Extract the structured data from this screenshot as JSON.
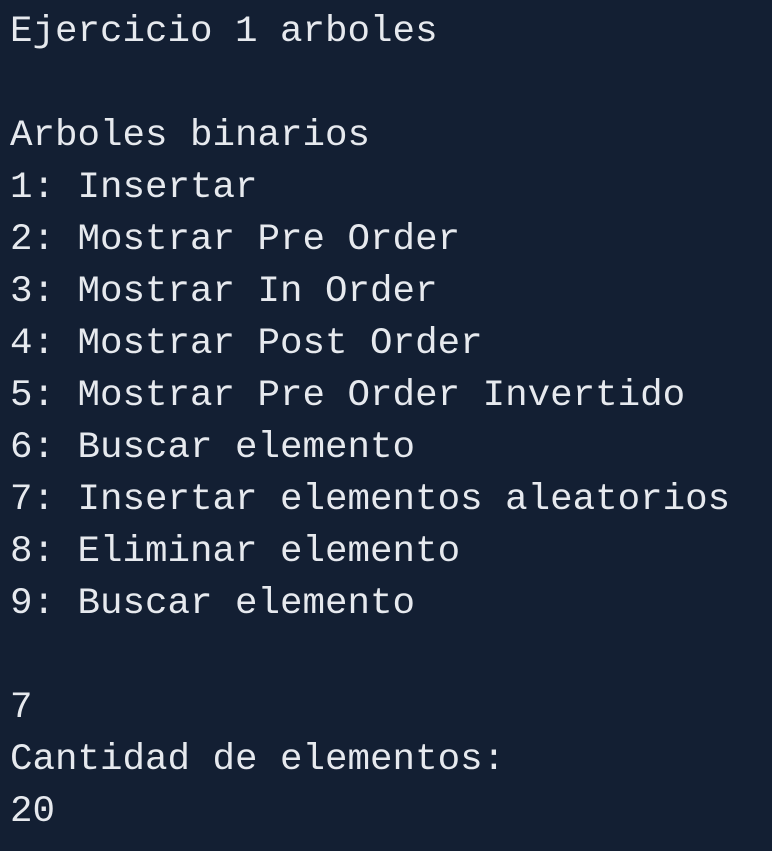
{
  "console": {
    "title": "Ejercicio 1 arboles",
    "menu_heading": "Arboles binarios",
    "menu_items": [
      "1: Insertar",
      "2: Mostrar Pre Order",
      "3: Mostrar In Order",
      "4: Mostrar Post Order",
      "5: Mostrar Pre Order Invertido",
      "6: Buscar elemento",
      "7: Insertar elementos aleatorios",
      "8: Eliminar elemento",
      "9: Buscar elemento"
    ],
    "user_choice": "7",
    "quantity_prompt": "Cantidad de elementos:",
    "quantity_input": "20"
  },
  "colors": {
    "background": "#131f33",
    "text": "#e6e9ee"
  }
}
